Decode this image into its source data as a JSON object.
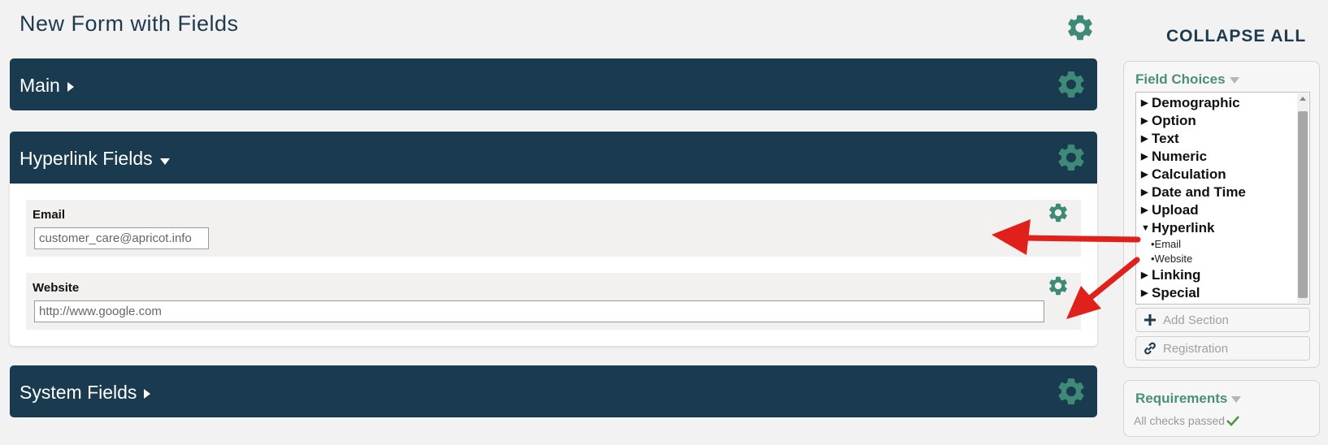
{
  "page": {
    "title": "New Form with Fields"
  },
  "sections": {
    "main": {
      "title": "Main"
    },
    "hyperlink": {
      "title": "Hyperlink Fields"
    },
    "system": {
      "title": "System Fields"
    }
  },
  "fields": {
    "email": {
      "label": "Email",
      "value": "customer_care@apricot.info"
    },
    "website": {
      "label": "Website",
      "placeholder": "http://www.google.com"
    }
  },
  "sidebar": {
    "collapse_all": "COLLAPSE ALL",
    "field_choices": {
      "heading": "Field Choices",
      "items": [
        {
          "label": "Demographic"
        },
        {
          "label": "Option"
        },
        {
          "label": "Text"
        },
        {
          "label": "Numeric"
        },
        {
          "label": "Calculation"
        },
        {
          "label": "Date and Time"
        },
        {
          "label": "Upload"
        },
        {
          "label": "Hyperlink",
          "sub": [
            "•Email",
            "•Website"
          ]
        },
        {
          "label": "Linking"
        },
        {
          "label": "Special"
        }
      ],
      "add_section": "Add Section",
      "registration": "Registration"
    },
    "requirements": {
      "heading": "Requirements",
      "status": "All checks passed"
    }
  },
  "colors": {
    "section_bg": "#1a3a50",
    "gear": "#3e8a76",
    "accent_green": "#4a8e7c",
    "annotation_arrow": "#e0201a"
  },
  "icons": [
    "gear-icon",
    "triangle-right-icon",
    "triangle-down-icon",
    "plus-icon",
    "link-icon",
    "check-icon"
  ]
}
